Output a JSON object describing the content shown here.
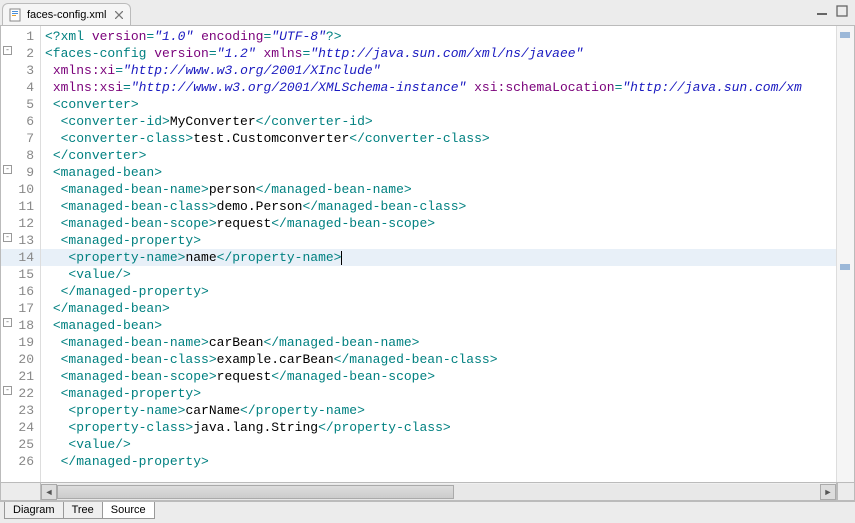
{
  "tab": {
    "filename": "faces-config.xml"
  },
  "bottom_tabs": {
    "diagram": "Diagram",
    "tree": "Tree",
    "source": "Source"
  },
  "gutter": {
    "lines": [
      "1",
      "2",
      "3",
      "4",
      "5",
      "6",
      "7",
      "8",
      "9",
      "10",
      "11",
      "12",
      "13",
      "14",
      "15",
      "16",
      "17",
      "18",
      "19",
      "20",
      "21",
      "22",
      "23",
      "24",
      "25",
      "26"
    ],
    "fold_at": [
      2,
      9,
      13,
      18,
      22
    ]
  },
  "highlighted_line": 14,
  "code": {
    "l1": {
      "pi_open": "<?xml ",
      "a1": "version",
      "eq": "=",
      "v1": "\"1.0\"",
      "sp": " ",
      "a2": "encoding",
      "v2": "\"UTF-8\"",
      "pi_close": "?>"
    },
    "l2": {
      "open": "<faces-config ",
      "a1": "version",
      "v1": "\"1.2\"",
      "a2": "xmlns",
      "v2": "\"http://java.sun.com/xml/ns/javaee\""
    },
    "l3": {
      "indent": " ",
      "a": "xmlns:xi",
      "v": "\"http://www.w3.org/2001/XInclude\""
    },
    "l4": {
      "indent": " ",
      "a1": "xmlns:xsi",
      "v1": "\"http://www.w3.org/2001/XMLSchema-instance\"",
      "a2": "xsi:schemaLocation",
      "v2": "\"http://java.sun.com/xm"
    },
    "l5": {
      "indent": " ",
      "tag": "<converter>"
    },
    "l6": {
      "indent": "  ",
      "open": "<converter-id>",
      "text": "MyConverter",
      "close": "</converter-id>"
    },
    "l7": {
      "indent": "  ",
      "open": "<converter-class>",
      "text": "test.Customconverter",
      "close": "</converter-class>"
    },
    "l8": {
      "indent": " ",
      "tag": "</converter>"
    },
    "l9": {
      "indent": " ",
      "tag": "<managed-bean>"
    },
    "l10": {
      "indent": "  ",
      "open": "<managed-bean-name>",
      "text": "person",
      "close": "</managed-bean-name>"
    },
    "l11": {
      "indent": "  ",
      "open": "<managed-bean-class>",
      "text": "demo.Person",
      "close": "</managed-bean-class>"
    },
    "l12": {
      "indent": "  ",
      "open": "<managed-bean-scope>",
      "text": "request",
      "close": "</managed-bean-scope>"
    },
    "l13": {
      "indent": "  ",
      "tag": "<managed-property>"
    },
    "l14": {
      "indent": "   ",
      "open": "<property-name>",
      "text": "name",
      "close": "</property-name>"
    },
    "l15": {
      "indent": "   ",
      "tag": "<value/>"
    },
    "l16": {
      "indent": "  ",
      "tag": "</managed-property>"
    },
    "l17": {
      "indent": " ",
      "tag": "</managed-bean>"
    },
    "l18": {
      "indent": " ",
      "tag": "<managed-bean>"
    },
    "l19": {
      "indent": "  ",
      "open": "<managed-bean-name>",
      "text": "carBean",
      "close": "</managed-bean-name>"
    },
    "l20": {
      "indent": "  ",
      "open": "<managed-bean-class>",
      "text": "example.carBean",
      "close": "</managed-bean-class>"
    },
    "l21": {
      "indent": "  ",
      "open": "<managed-bean-scope>",
      "text": "request",
      "close": "</managed-bean-scope>"
    },
    "l22": {
      "indent": "  ",
      "tag": "<managed-property>"
    },
    "l23": {
      "indent": "   ",
      "open": "<property-name>",
      "text": "carName",
      "close": "</property-name>"
    },
    "l24": {
      "indent": "   ",
      "open": "<property-class>",
      "text": "java.lang.String",
      "close": "</property-class>"
    },
    "l25": {
      "indent": "   ",
      "tag": "<value/>"
    },
    "l26": {
      "indent": "  ",
      "tag": "</managed-property>"
    }
  }
}
